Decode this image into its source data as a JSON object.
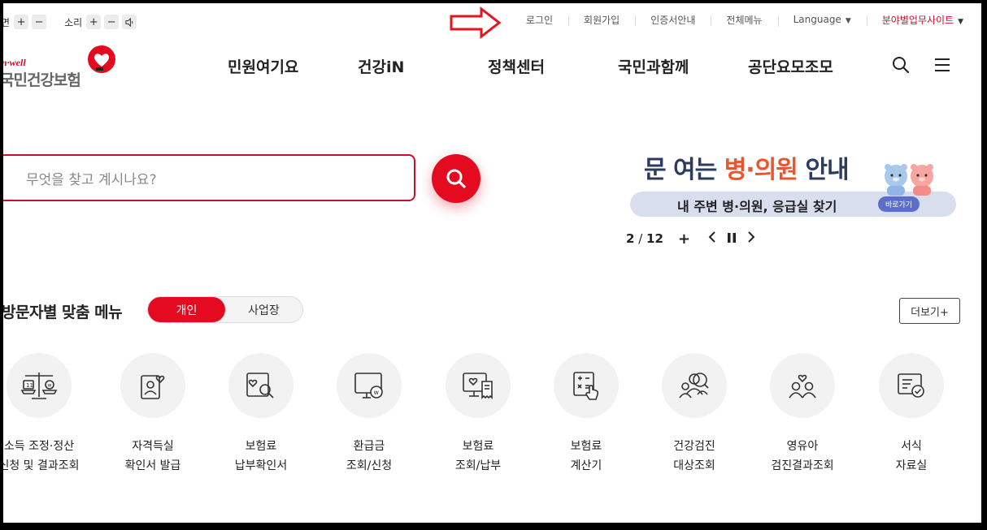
{
  "utility": {
    "screen_label": "화면",
    "sound_label": "소리",
    "plus": "+",
    "minus": "−",
    "links": [
      "로그인",
      "회원가입",
      "인증서안내",
      "전체메뉴",
      "Language",
      "분야별업무사이트"
    ]
  },
  "logo": {
    "tagline": "n·well",
    "name": "국민건강보험"
  },
  "gnb": [
    "민원여기요",
    "건강iN",
    "정책센터",
    "국민과함께",
    "공단요모조모"
  ],
  "search": {
    "placeholder": "무엇을 찾고 계시나요?"
  },
  "banner": {
    "title_pre": "문 여는 ",
    "title_accent": "병·의원",
    "title_post": " 안내",
    "subtitle": "내 주변 병·의원, 응급실 찾기",
    "go_label": "바로가기",
    "page_current": "2",
    "page_sep": " / ",
    "page_total": "12"
  },
  "visitor": {
    "title": "방문자별 맞춤 메뉴",
    "tab_personal": "개인",
    "tab_business": "사업장",
    "more": "더보기+"
  },
  "quick_menu": [
    {
      "line1": "소득 조정·정산",
      "line2": "신청 및 결과조회",
      "icon": "scale-icon"
    },
    {
      "line1": "자격득실",
      "line2": "확인서 발급",
      "icon": "id-card-heart-icon"
    },
    {
      "line1": "보험료",
      "line2": "납부확인서",
      "icon": "document-search-icon"
    },
    {
      "line1": "환급금",
      "line2": "조회/신청",
      "icon": "monitor-won-icon"
    },
    {
      "line1": "보험료",
      "line2": "조회/납부",
      "icon": "monitor-receipt-icon"
    },
    {
      "line1": "보험료",
      "line2": "계산기",
      "icon": "calculator-icon"
    },
    {
      "line1": "건강검진",
      "line2": "대상조회",
      "icon": "person-search-icon"
    },
    {
      "line1": "영유아",
      "line2": "검진결과조회",
      "icon": "family-heart-icon"
    },
    {
      "line1": "서식",
      "line2": "자료실",
      "icon": "form-check-icon"
    }
  ],
  "colors": {
    "brand_red": "#e40a20",
    "banner_navy": "#2c3c5c",
    "banner_orange": "#e8562e",
    "pill_bg": "#d9deef",
    "pill_button": "#5b6fc9"
  }
}
